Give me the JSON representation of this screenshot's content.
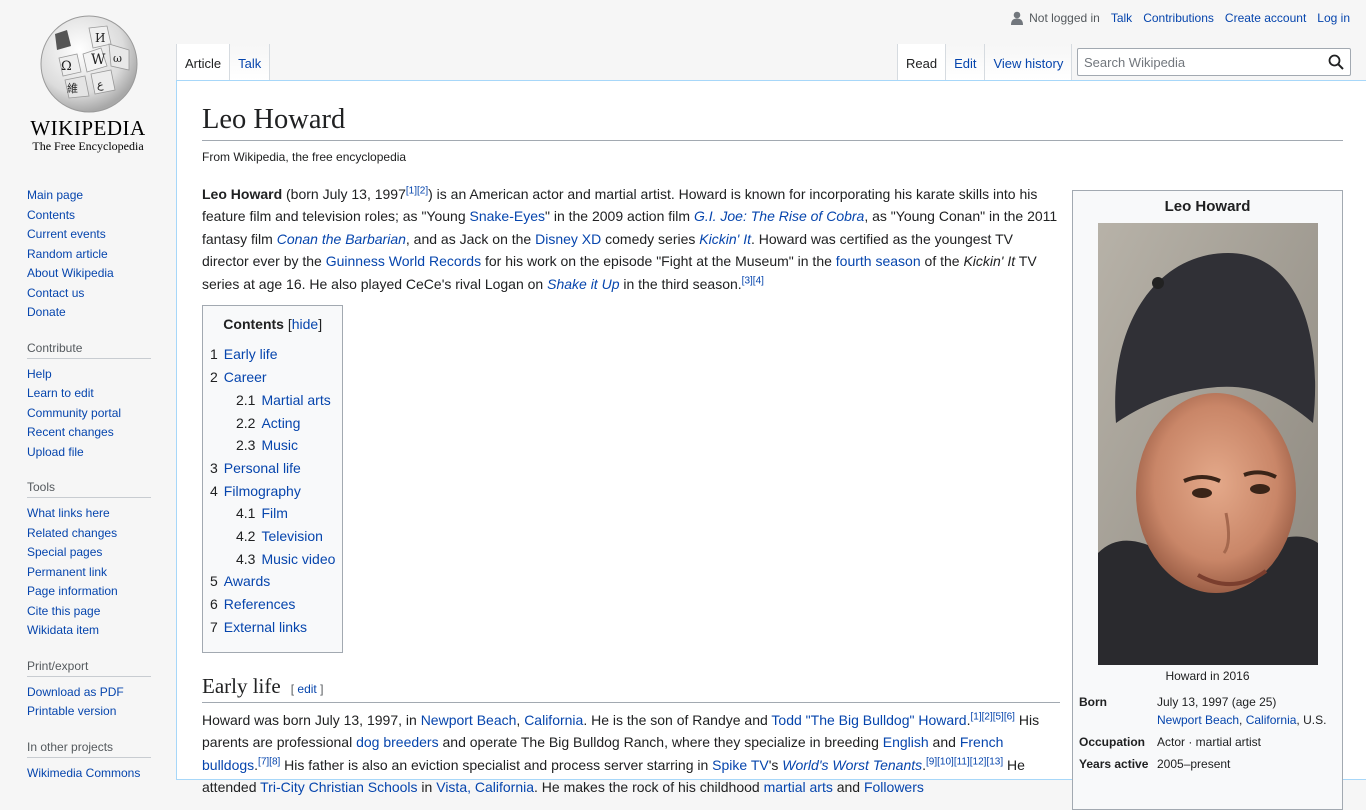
{
  "logo": {
    "wordmark": "WIKIPEDIA",
    "tagline": "The Free Encyclopedia"
  },
  "personal": {
    "anon_icon": "user-icon",
    "not_logged_in": "Not logged in",
    "talk": "Talk",
    "contributions": "Contributions",
    "create_account": "Create account",
    "login": "Log in"
  },
  "tabs": {
    "article": "Article",
    "talk": "Talk",
    "read": "Read",
    "edit": "Edit",
    "view_history": "View history"
  },
  "search": {
    "placeholder": "Search Wikipedia",
    "icon": "search-icon"
  },
  "sidebar": {
    "navigation": [
      "Main page",
      "Contents",
      "Current events",
      "Random article",
      "About Wikipedia",
      "Contact us",
      "Donate"
    ],
    "contribute": {
      "heading": "Contribute",
      "items": [
        "Help",
        "Learn to edit",
        "Community portal",
        "Recent changes",
        "Upload file"
      ]
    },
    "tools": {
      "heading": "Tools",
      "items": [
        "What links here",
        "Related changes",
        "Special pages",
        "Permanent link",
        "Page information",
        "Cite this page",
        "Wikidata item"
      ]
    },
    "print": {
      "heading": "Print/export",
      "items": [
        "Download as PDF",
        "Printable version"
      ]
    },
    "projects": {
      "heading": "In other projects",
      "items": [
        "Wikimedia Commons"
      ]
    }
  },
  "article": {
    "title": "Leo Howard",
    "site_sub": "From Wikipedia, the free encyclopedia",
    "intro": {
      "t1": "Leo Howard",
      "t2": " (born July 13, 1997",
      "r1": "[1]",
      "r2": "[2]",
      "t3": ") is an American actor and martial artist. Howard is known for incorporating his karate skills into his feature film and television roles; as \"Young ",
      "l1": "Snake-Eyes",
      "t4": "\" in the 2009 action film ",
      "l2": "G.I. Joe: The Rise of Cobra",
      "t5": ", as \"Young Conan\" in the 2011 fantasy film ",
      "l3": "Conan the Barbarian",
      "t6": ", and as Jack on the ",
      "l4": "Disney XD",
      "t7": " comedy series ",
      "l5": "Kickin' It",
      "t8": ". Howard was certified as the youngest TV director ever by the ",
      "l6": "Guinness World Records",
      "t9": " for his work on the episode \"Fight at the Museum\" in the ",
      "l7": "fourth season",
      "t10": " of the ",
      "i1": "Kickin' It",
      "t11": " TV series at age 16. He also played CeCe's rival Logan on ",
      "l8": "Shake it Up",
      "t12": " in the third season.",
      "r3": "[3]",
      "r4": "[4]"
    },
    "toc": {
      "title": "Contents",
      "hide": "hide",
      "items": [
        {
          "num": "1",
          "label": "Early life"
        },
        {
          "num": "2",
          "label": "Career"
        },
        {
          "num": "2.1",
          "label": "Martial arts"
        },
        {
          "num": "2.2",
          "label": "Acting"
        },
        {
          "num": "2.3",
          "label": "Music"
        },
        {
          "num": "3",
          "label": "Personal life"
        },
        {
          "num": "4",
          "label": "Filmography"
        },
        {
          "num": "4.1",
          "label": "Film"
        },
        {
          "num": "4.2",
          "label": "Television"
        },
        {
          "num": "4.3",
          "label": "Music video"
        },
        {
          "num": "5",
          "label": "Awards"
        },
        {
          "num": "6",
          "label": "References"
        },
        {
          "num": "7",
          "label": "External links"
        }
      ]
    },
    "early_life": {
      "heading": "Early life",
      "edit": "edit",
      "t1": "Howard was born July 13, 1997, in ",
      "l1": "Newport Beach",
      "t2": ", ",
      "l2": "California",
      "t3": ". He is the son of Randye and ",
      "l3": "Todd \"The Big Bulldog\" Howard",
      "t4": ".",
      "r1": "[1][2][5][6]",
      "t5": " His parents are professional ",
      "l4": "dog breeders",
      "t6": " and operate The Big Bulldog Ranch, where they specialize in breeding ",
      "l5": "English",
      "t7": " and ",
      "l6": "French bulldogs",
      "t8": ".",
      "r2": "[7][8]",
      "t9": " His father is also an eviction specialist and process server starring in ",
      "l7": "Spike TV",
      "t10": "'s ",
      "l8": "World's Worst Tenants",
      "t11": ".",
      "r3": "[9][10][11][12][13]",
      "t12": " He attended ",
      "l9": "Tri-City Christian Schools",
      "t13": " in ",
      "l10": "Vista, California",
      "t14": ". He makes the rock of his childhood ",
      "l11": "martial arts",
      "t15": " and ",
      "l12": "Followers"
    }
  },
  "infobox": {
    "title": "Leo Howard",
    "caption": "Howard in 2016",
    "born_label": "Born",
    "born_date": "July 13, 1997 (age 25)",
    "born_place_1": "Newport Beach",
    "born_place_sep": ", ",
    "born_place_2": "California",
    "born_place_3": ", U.S.",
    "occupation_label": "Occupation",
    "occupation": "Actor · martial artist",
    "years_label": "Years active",
    "years": "2005–present"
  }
}
